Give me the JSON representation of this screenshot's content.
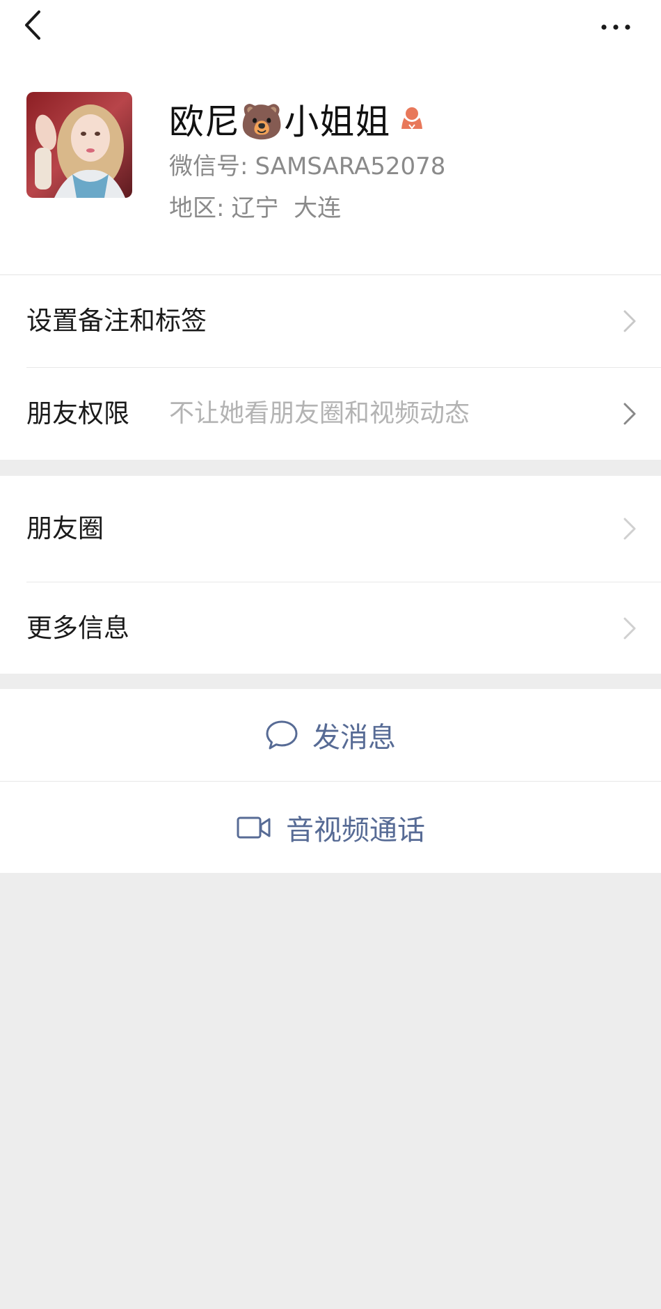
{
  "header": {
    "back_icon": "chevron-left-icon",
    "more_icon": "more-dots-icon"
  },
  "profile": {
    "name": "欧尼🐻小姐姐",
    "gender_icon": "female-gender-icon",
    "wechat_id_label": "微信号:",
    "wechat_id": "SAMSARA52078",
    "region_label": "地区:",
    "region": "辽宁  大连",
    "accent_color": "#e8785a"
  },
  "menu": {
    "remark_tags": "设置备注和标签",
    "friend_permission": "朋友权限",
    "friend_permission_value": "不让她看朋友圈和视频动态",
    "moments": "朋友圈",
    "more_info": "更多信息"
  },
  "actions": {
    "send_message": "发消息",
    "av_call": "音视频通话",
    "link_color": "#576b95"
  }
}
